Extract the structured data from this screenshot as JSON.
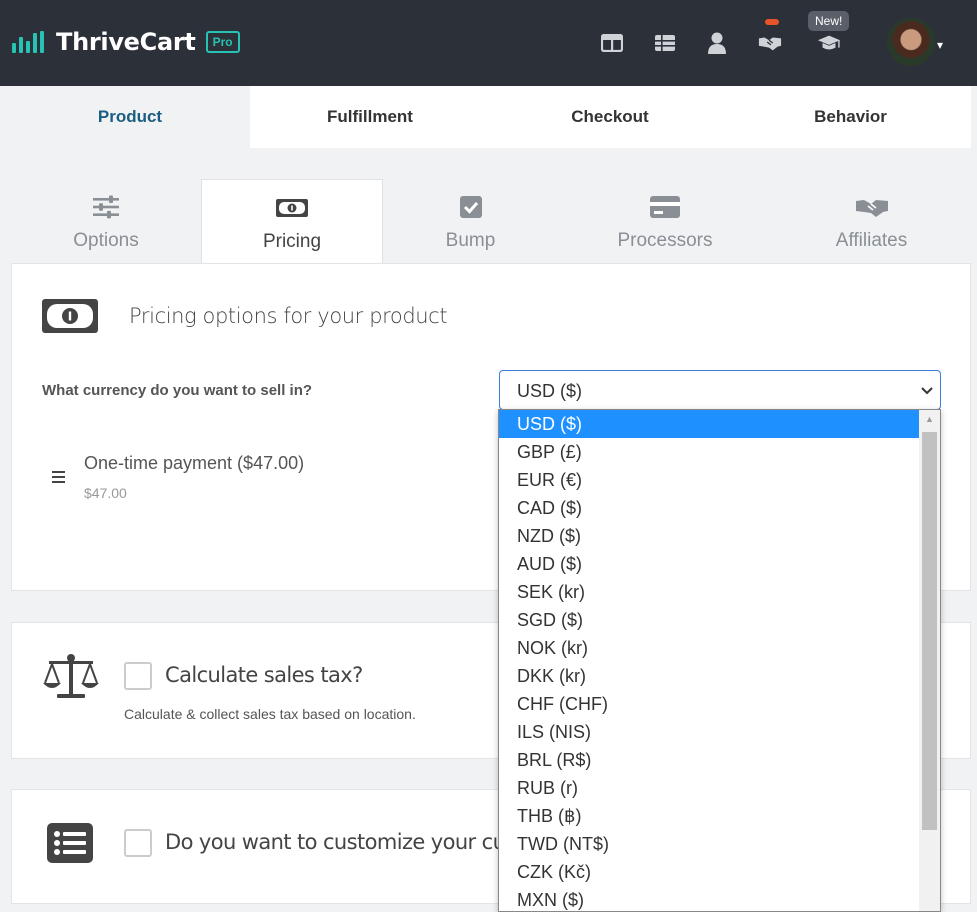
{
  "brand": {
    "name": "ThriveCart",
    "badge": "Pro",
    "accent": "#27c2b3"
  },
  "topnav": {
    "icons": [
      "dashboard-icon",
      "table-icon",
      "user-icon",
      "handshake-icon",
      "graduation-cap-icon"
    ],
    "new_badge": "New!",
    "avatar_caret": "▾"
  },
  "main_tabs": [
    {
      "label": "Product",
      "active": true
    },
    {
      "label": "Fulfillment",
      "active": false
    },
    {
      "label": "Checkout",
      "active": false
    },
    {
      "label": "Behavior",
      "active": false
    }
  ],
  "sub_tabs": [
    {
      "label": "Options",
      "icon": "sliders-icon",
      "active": false
    },
    {
      "label": "Pricing",
      "icon": "money-bill-icon",
      "active": true
    },
    {
      "label": "Bump",
      "icon": "check-square-icon",
      "active": false
    },
    {
      "label": "Processors",
      "icon": "credit-card-icon",
      "active": false
    },
    {
      "label": "Affiliates",
      "icon": "handshake-icon",
      "active": false
    }
  ],
  "pricing": {
    "title": "Pricing options for your product",
    "currency_label": "What currency do you want to sell in?",
    "selected_currency": "USD ($)",
    "payment": {
      "title": "One-time payment ($47.00)",
      "amount": "$47.00"
    }
  },
  "tax": {
    "title": "Calculate sales tax?",
    "description": "Calculate & collect sales tax based on location."
  },
  "customize": {
    "title": "Do you want to customize your custor"
  },
  "currency_options": [
    "USD ($)",
    "GBP (£)",
    "EUR (€)",
    "CAD ($)",
    "NZD ($)",
    "AUD ($)",
    "SEK (kr)",
    "SGD ($)",
    "NOK (kr)",
    "DKK (kr)",
    "CHF (CHF)",
    "ILS (NIS)",
    "BRL (R$)",
    "RUB (r)",
    "THB (฿)",
    "TWD (NT$)",
    "CZK (Kč)",
    "MXN ($)"
  ],
  "colors": {
    "topbar": "#2c3038",
    "selection": "#1e90ff",
    "notification": "#e8532c"
  }
}
